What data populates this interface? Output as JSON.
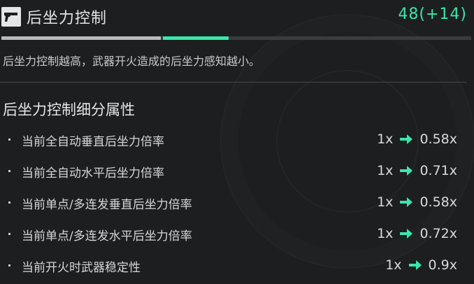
{
  "header": {
    "title": "后坐力控制",
    "value": "48(+14)",
    "weapon_icon": "pistol-icon",
    "bar": {
      "base_fraction": 0.34,
      "bonus_fraction": 0.14
    }
  },
  "description": "后坐力控制越高，武器开火造成的后坐力感知越小。",
  "section": {
    "title": "后坐力控制细分属性",
    "rows": [
      {
        "label": "当前全自动垂直后坐力倍率",
        "from": "1x",
        "to": "0.58x"
      },
      {
        "label": "当前全自动水平后坐力倍率",
        "from": "1x",
        "to": "0.71x"
      },
      {
        "label": "当前单点/多连发垂直后坐力倍率",
        "from": "1x",
        "to": "0.58x"
      },
      {
        "label": "当前单点/多连发水平后坐力倍率",
        "from": "1x",
        "to": "0.72x"
      },
      {
        "label": "当前开火时武器稳定性",
        "from": "1x",
        "to": "0.9x"
      }
    ]
  },
  "colors": {
    "accent": "#3be6a9",
    "text": "#d8dadc",
    "background": "#1c1e20"
  }
}
